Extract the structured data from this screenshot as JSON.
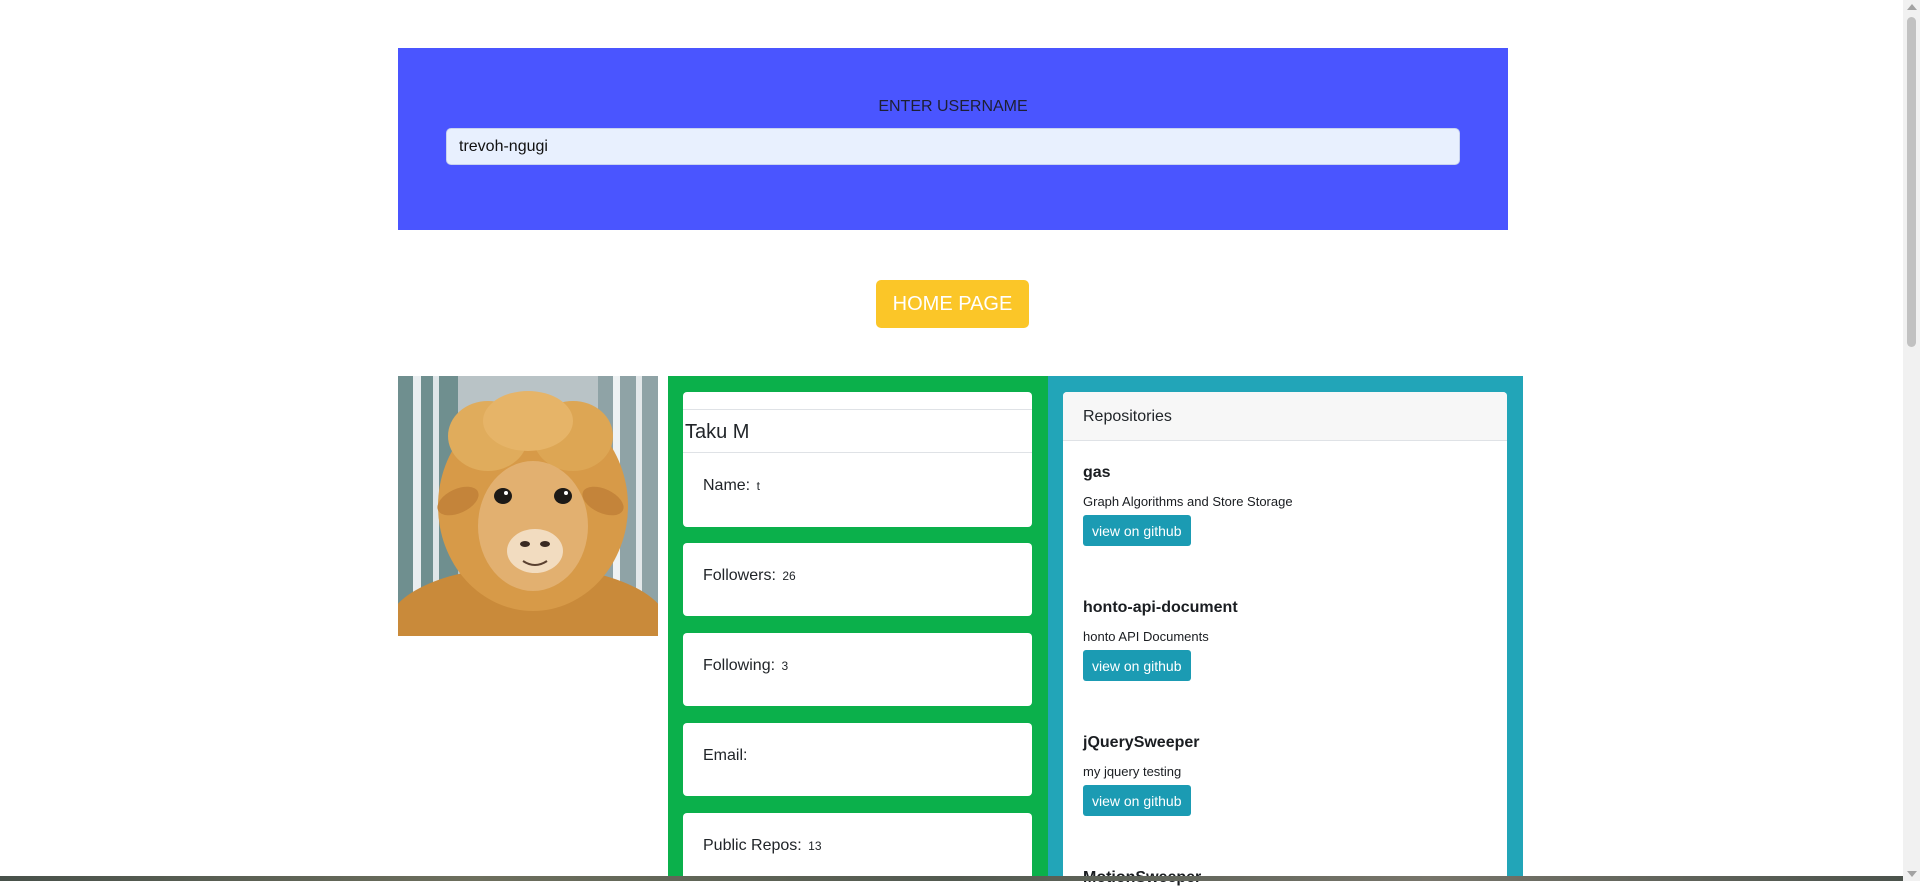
{
  "search": {
    "label": "ENTER USERNAME",
    "value": "trevoh-ngugi"
  },
  "home_button": "HOME PAGE",
  "profile": {
    "avatar_alt": "llama avatar",
    "title": "Taku M",
    "name_label": "Name:",
    "name_value": "t",
    "followers_label": "Followers:",
    "followers_value": "26",
    "following_label": "Following:",
    "following_value": "3",
    "email_label": "Email:",
    "email_value": "",
    "public_repos_label": "Public Repos:",
    "public_repos_value": "13"
  },
  "repositories": {
    "header": "Repositories",
    "items": [
      {
        "name": "gas",
        "description": "Graph Algorithms and Store Storage",
        "button": "view on github"
      },
      {
        "name": "honto-api-document",
        "description": "honto API Documents",
        "button": "view on github"
      },
      {
        "name": "jQuerySweeper",
        "description": "my jquery testing",
        "button": "view on github"
      },
      {
        "name": "MotionSweeper"
      }
    ]
  },
  "colors": {
    "search_panel": "#4a55ff",
    "home_button": "#fbc628",
    "profile_column": "#0bb04b",
    "repo_column": "#22a5b8",
    "repo_button": "#1b9bb3"
  }
}
